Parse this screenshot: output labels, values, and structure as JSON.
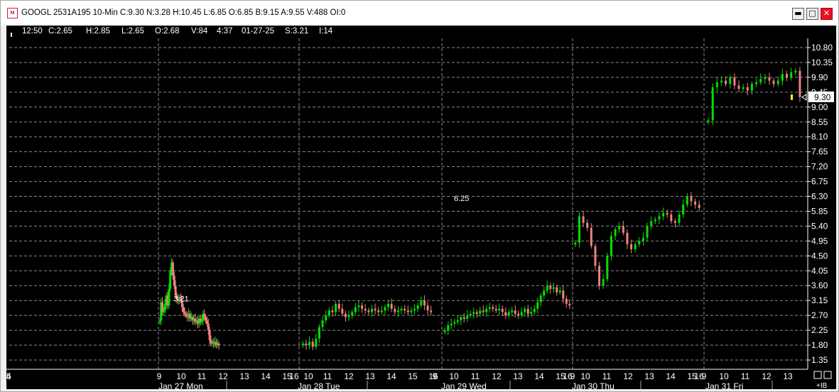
{
  "window": {
    "title": "GOOGL 2531A195 10-Min C:9.30 N:3.28 H:10.45 L:6.85 O:6.85 B:9.15 A:9.55 V:488 OI:0",
    "icon_name": "chart-app-icon",
    "buttons": {
      "minimize": "▬",
      "maximize": "□",
      "close": "✕"
    }
  },
  "infobar": {
    "time": "12:50",
    "close": "C:2.65",
    "high": "H:2.85",
    "low": "L:2.65",
    "open": "O:2.68",
    "volume": "V:84",
    "elapsed": "4:37",
    "date": "01-27-25",
    "s": "S:3.21",
    "i": "I:14"
  },
  "chart_data": {
    "type": "candlestick",
    "y_ticks": [
      "10.80",
      "10.35",
      "9.90",
      "9.45",
      "9.00",
      "8.55",
      "8.10",
      "7.65",
      "7.20",
      "6.75",
      "6.30",
      "5.85",
      "5.40",
      "4.95",
      "4.50",
      "4.05",
      "3.60",
      "3.15",
      "2.70",
      "2.25",
      "1.80",
      "1.35"
    ],
    "ylim": [
      1.2,
      10.95
    ],
    "last_price_label": "9.30",
    "last_price": 9.3,
    "annotations": [
      {
        "text": "3.21",
        "day": 0,
        "slot": 11,
        "value": 3.21
      },
      {
        "text": "6.25",
        "day": 2,
        "slot": 0,
        "value": 6.25
      }
    ],
    "x_hour_labels": [
      [
        "9",
        "10",
        "11",
        "12",
        "13",
        "14",
        "15",
        "16"
      ],
      [
        "10",
        "11",
        "12",
        "13",
        "14",
        "15",
        "16"
      ],
      [
        "9",
        "10",
        "11",
        "12",
        "13",
        "14",
        "15",
        "16"
      ],
      [
        "9",
        "10",
        "11",
        "12",
        "13",
        "14",
        "15",
        "16"
      ],
      [
        "9",
        "10",
        "11",
        "12",
        "13",
        "14",
        "15"
      ]
    ],
    "day_labels": [
      "Jan 27 Mon",
      "Jan 28 Tue",
      "Jan 29 Wed",
      "Jan 30 Thu",
      "Jan 31 Fri"
    ],
    "corner_label": "+IB",
    "colors": {
      "up": "#00e000",
      "down": "#f08080",
      "grid": "#8c8c8c",
      "last": "#ffff00",
      "text": "#ffffff"
    },
    "days": [
      {
        "day": "Jan 27",
        "closes": [
          2.55,
          3.1,
          2.8,
          2.85,
          3.05,
          3.3,
          3.0,
          3.5,
          4.05,
          4.3,
          3.9,
          3.6,
          3.3,
          3.2,
          3.15,
          3.25,
          3.15,
          2.95,
          2.8,
          2.75,
          2.7,
          2.65,
          2.75,
          2.6,
          2.65,
          2.55,
          2.6,
          2.5,
          2.55,
          2.45,
          2.6,
          2.5,
          2.55,
          2.75,
          2.65,
          2.55,
          2.45,
          2.25,
          1.95,
          1.85,
          1.9,
          1.85,
          1.9,
          1.8,
          1.85,
          1.8
        ]
      },
      {
        "day": "Jan 28",
        "closes": [
          1.85,
          1.8,
          1.9,
          1.75,
          2.0,
          2.35,
          2.55,
          2.7,
          2.85,
          2.8,
          3.05,
          2.9,
          2.75,
          2.65,
          2.7,
          2.8,
          2.95,
          3.0,
          2.9,
          2.85,
          2.8,
          2.9,
          2.85,
          2.8,
          2.85,
          2.95,
          3.05,
          2.9,
          2.8,
          2.85,
          2.9,
          2.85,
          2.8,
          2.85,
          2.9,
          3.0,
          3.15,
          3.0,
          2.85,
          2.8
        ]
      },
      {
        "day": "Jan 29",
        "closes": [
          2.25,
          2.4,
          2.45,
          2.5,
          2.55,
          2.65,
          2.6,
          2.7,
          2.75,
          2.8,
          2.75,
          2.85,
          2.8,
          2.9,
          2.95,
          2.9,
          2.85,
          2.9,
          2.8,
          2.7,
          2.8,
          2.85,
          2.75,
          2.7,
          2.8,
          2.9,
          2.75,
          2.8,
          2.9,
          3.1,
          3.3,
          3.45,
          3.6,
          3.5,
          3.55,
          3.4,
          3.45,
          3.2,
          3.05,
          3.0
        ]
      },
      {
        "day": "Jan 30",
        "closes": [
          4.9,
          5.7,
          5.5,
          5.35,
          4.8,
          4.2,
          3.6,
          3.8,
          4.5,
          5.1,
          5.3,
          5.4,
          5.2,
          4.85,
          4.7,
          4.85,
          4.95,
          5.05,
          5.4,
          5.55,
          5.6,
          5.7,
          5.8,
          5.75,
          5.55,
          5.5,
          5.75,
          6.05,
          6.3,
          6.15,
          6.05,
          5.95
        ]
      },
      {
        "day": "Jan 31",
        "closes": [
          8.6,
          9.6,
          9.75,
          9.8,
          9.7,
          9.9,
          9.65,
          9.55,
          9.6,
          9.5,
          9.7,
          9.75,
          9.85,
          9.9,
          9.8,
          9.7,
          9.8,
          10.0,
          9.9,
          10.05,
          10.1,
          9.3
        ]
      }
    ]
  }
}
